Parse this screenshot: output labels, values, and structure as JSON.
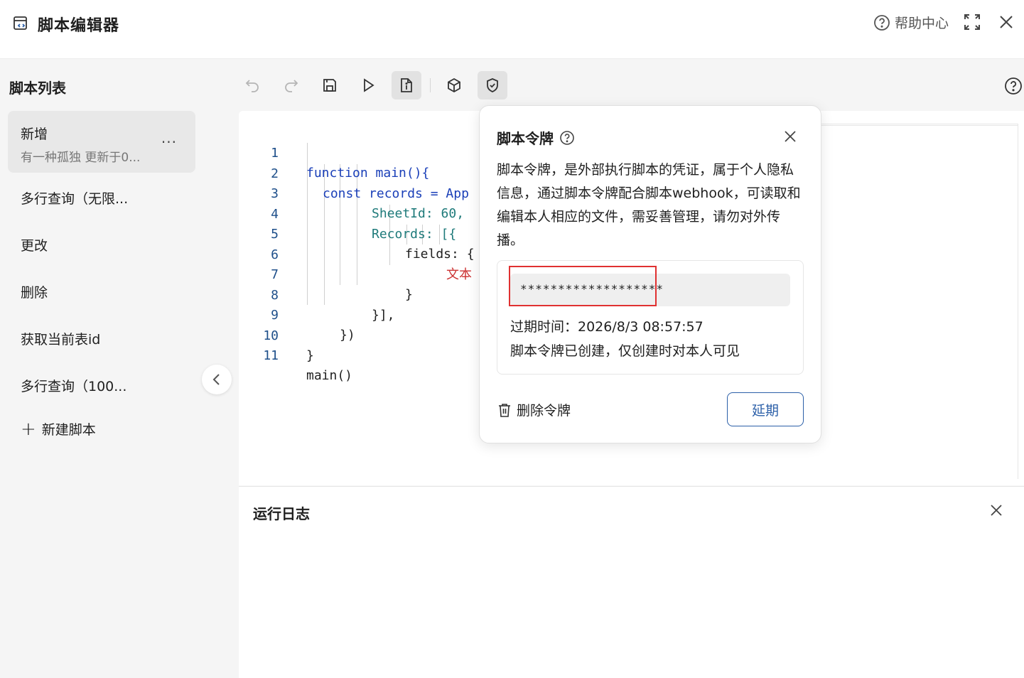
{
  "header": {
    "title": "脚本编辑器",
    "help_label": "帮助中心"
  },
  "sidebar": {
    "title": "脚本列表",
    "items": [
      {
        "name": "新增",
        "subtitle": "有一种孤独 更新于0...",
        "more": "..."
      },
      {
        "name": "多行查询（无限..."
      },
      {
        "name": "更改"
      },
      {
        "name": "删除"
      },
      {
        "name": "获取当前表id"
      },
      {
        "name": "多行查询（100..."
      }
    ],
    "new_script_label": "新建脚本"
  },
  "editor": {
    "lines": [
      {
        "no": "1",
        "text": "function main(){"
      },
      {
        "no": "2",
        "text": "const records = App"
      },
      {
        "no": "3",
        "text": "SheetId: 60,"
      },
      {
        "no": "4",
        "text": "Records: [{"
      },
      {
        "no": "5",
        "text": "fields: {"
      },
      {
        "no": "6",
        "text": "文本"
      },
      {
        "no": "7",
        "text": "}"
      },
      {
        "no": "8",
        "text": "}],"
      },
      {
        "no": "9",
        "text": "})"
      },
      {
        "no": "10",
        "text": "}"
      },
      {
        "no": "11",
        "text": "main()"
      }
    ]
  },
  "runlog": {
    "title": "运行日志"
  },
  "token_popover": {
    "title": "脚本令牌",
    "description": "脚本令牌，是外部执行脚本的凭证，属于个人隐私信息，通过脚本令牌配合脚本webhook，可读取和编辑本人相应的文件，需妥善管理，请勿对外传播。",
    "token_value": "*******************",
    "expiry": "过期时间：2026/8/3 08:57:57",
    "note": "脚本令牌已创建，仅创建时对本人可见",
    "delete_label": "删除令牌",
    "extend_label": "延期"
  },
  "colors": {
    "accent": "#2b5fa8",
    "highlight_border": "#e03131",
    "keyword": "#1a3fb8",
    "property": "#1e7a7a"
  }
}
